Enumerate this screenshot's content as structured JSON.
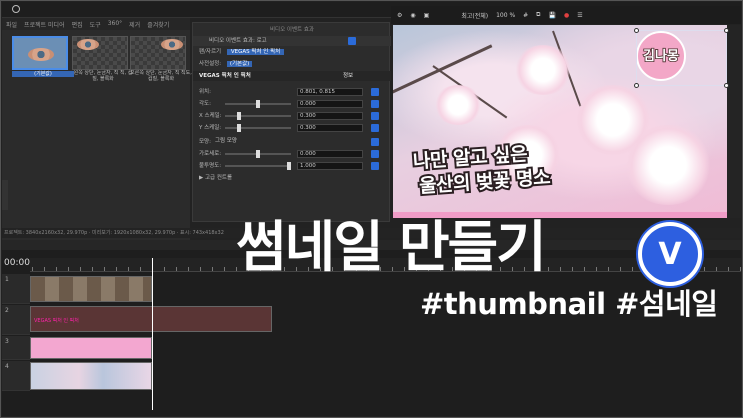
{
  "app": {
    "tabs": [
      "파일",
      "프로젝트 미디어",
      "편집",
      "도구",
      "360°",
      "제거",
      "즐겨찾기"
    ]
  },
  "media": {
    "items": [
      {
        "caption": "(기본값)"
      },
      {
        "caption": "왼쪽 상단, 눈금자, 직 직, 컵질, 블록화"
      },
      {
        "caption": "오른쪽 상단, 눈금자, 직 직도, 컵질, 블록화"
      }
    ]
  },
  "fx_panel": {
    "title": "비디오 이벤트 효과",
    "subtitle": "비디오 이벤트 효과: 로고",
    "chain_label": "팬/자르기",
    "chain_item": "VEGAS 픽처 인 픽처",
    "preset_label": "사전설정:",
    "preset_value": "(기본값)",
    "plugin_name": "VEGAS 픽처 인 픽처",
    "about_label": "정보",
    "rows": [
      {
        "label": "위치:",
        "value": "0.801, 0.815"
      },
      {
        "label": "각도:",
        "value": "0.000"
      },
      {
        "label": "X 스케일:",
        "value": "0.300"
      },
      {
        "label": "Y 스케일:",
        "value": "0.300"
      },
      {
        "label": "모양:",
        "value": "그림 모양"
      },
      {
        "label": "가로세로:",
        "value": "0.000"
      },
      {
        "label": "불투명도:",
        "value": "1.000"
      }
    ],
    "advanced_label": "고급 컨트롤"
  },
  "preview": {
    "quality": "최고(전체)",
    "zoom": "100 %",
    "logo_text": "김나몽",
    "line1": "나만 알고 싶은",
    "line2": "울산의 벚꽃 명소"
  },
  "status": {
    "text": "프로젝트: 3840x2160x32, 29.970p · 미리보기: 1920x1080x32, 29.970p · 표시: 743x418x32"
  },
  "timeline": {
    "timecode": "00:00",
    "tracks": [
      {
        "id": "1"
      },
      {
        "id": "2"
      },
      {
        "id": "3"
      },
      {
        "id": "4"
      }
    ],
    "clip_label": "VEGAS 픽처 인 픽처"
  },
  "overlay": {
    "title": "썸네일 만들기",
    "badge": "V",
    "hashtags": "#thumbnail #섬네일"
  },
  "colors": {
    "accent_blue": "#2d5fe0",
    "pink": "#f09cc7"
  }
}
